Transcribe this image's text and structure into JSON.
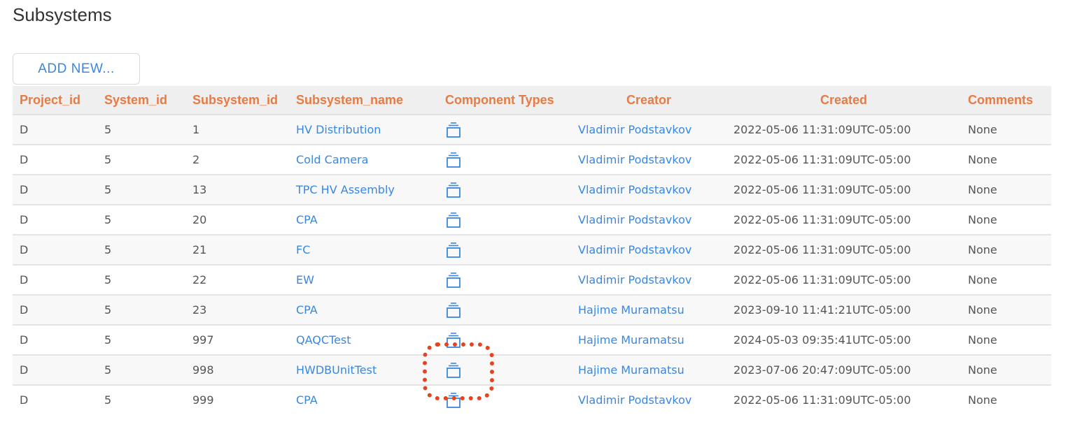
{
  "page": {
    "title": "Subsystems",
    "add_button_label": "ADD NEW..."
  },
  "colors": {
    "header_text": "#e87a43",
    "link": "#3a87e0",
    "highlight": "#e8431f"
  },
  "table": {
    "columns": [
      "Project_id",
      "System_id",
      "Subsystem_id",
      "Subsystem_name",
      "Component Types",
      "Creator",
      "Created",
      "Comments"
    ],
    "rows": [
      {
        "project_id": "D",
        "system_id": "5",
        "subsystem_id": "1",
        "subsystem_name": "HV Distribution",
        "component_types_icon": "component-types-icon",
        "creator": "Vladimir Podstavkov",
        "created": "2022-05-06 11:31:09UTC-05:00",
        "comments": "None"
      },
      {
        "project_id": "D",
        "system_id": "5",
        "subsystem_id": "2",
        "subsystem_name": "Cold Camera",
        "component_types_icon": "component-types-icon",
        "creator": "Vladimir Podstavkov",
        "created": "2022-05-06 11:31:09UTC-05:00",
        "comments": "None"
      },
      {
        "project_id": "D",
        "system_id": "5",
        "subsystem_id": "13",
        "subsystem_name": "TPC HV Assembly",
        "component_types_icon": "component-types-icon",
        "creator": "Vladimir Podstavkov",
        "created": "2022-05-06 11:31:09UTC-05:00",
        "comments": "None"
      },
      {
        "project_id": "D",
        "system_id": "5",
        "subsystem_id": "20",
        "subsystem_name": "CPA",
        "component_types_icon": "component-types-icon",
        "creator": "Vladimir Podstavkov",
        "created": "2022-05-06 11:31:09UTC-05:00",
        "comments": "None"
      },
      {
        "project_id": "D",
        "system_id": "5",
        "subsystem_id": "21",
        "subsystem_name": "FC",
        "component_types_icon": "component-types-icon",
        "creator": "Vladimir Podstavkov",
        "created": "2022-05-06 11:31:09UTC-05:00",
        "comments": "None"
      },
      {
        "project_id": "D",
        "system_id": "5",
        "subsystem_id": "22",
        "subsystem_name": "EW",
        "component_types_icon": "component-types-icon",
        "creator": "Vladimir Podstavkov",
        "created": "2022-05-06 11:31:09UTC-05:00",
        "comments": "None"
      },
      {
        "project_id": "D",
        "system_id": "5",
        "subsystem_id": "23",
        "subsystem_name": "CPA",
        "component_types_icon": "component-types-icon",
        "creator": "Hajime Muramatsu",
        "created": "2023-09-10 11:41:21UTC-05:00",
        "comments": "None"
      },
      {
        "project_id": "D",
        "system_id": "5",
        "subsystem_id": "997",
        "subsystem_name": "QAQCTest",
        "component_types_icon": "component-types-icon",
        "creator": "Hajime Muramatsu",
        "created": "2024-05-03 09:35:41UTC-05:00",
        "comments": "None"
      },
      {
        "project_id": "D",
        "system_id": "5",
        "subsystem_id": "998",
        "subsystem_name": "HWDBUnitTest",
        "component_types_icon": "component-types-icon",
        "creator": "Hajime Muramatsu",
        "created": "2023-07-06 20:47:09UTC-05:00",
        "comments": "None"
      },
      {
        "project_id": "D",
        "system_id": "5",
        "subsystem_id": "999",
        "subsystem_name": "CPA",
        "component_types_icon": "component-types-icon",
        "creator": "Vladimir Podstavkov",
        "created": "2022-05-06 11:31:09UTC-05:00",
        "comments": "None"
      }
    ]
  },
  "annotation": {
    "highlighted_row_index": 8,
    "highlighted_column": "Component Types"
  }
}
